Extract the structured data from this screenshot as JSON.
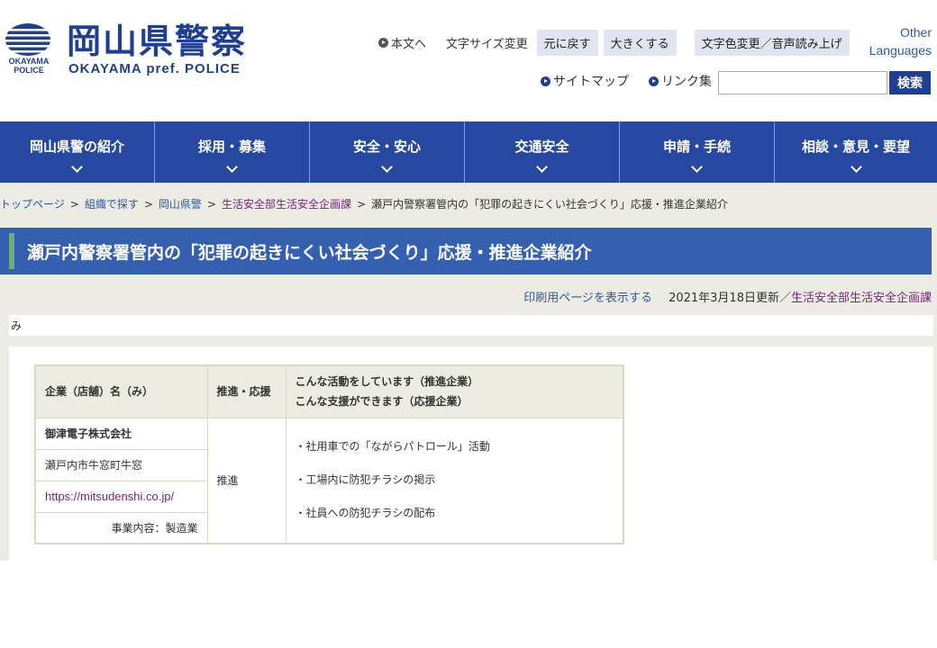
{
  "header": {
    "logo_mark_text": "OKAYAMA POLICE",
    "logo_title": "岡山県警察",
    "logo_sub": "OKAYAMA pref. POLICE",
    "skip_link": "本文へ",
    "font_size_label": "文字サイズ変更",
    "font_reset": "元に戻す",
    "font_larger": "大きくする",
    "color_voice": "文字色変更／音声読み上げ",
    "other_lang_1": "Other",
    "other_lang_2": "Languages",
    "sitemap": "サイトマップ",
    "links": "リンク集",
    "search_placeholder": "",
    "search_button": "検索"
  },
  "nav": {
    "items": [
      {
        "label": "岡山県警の紹介"
      },
      {
        "label": "採用・募集"
      },
      {
        "label": "安全・安心"
      },
      {
        "label": "交通安全"
      },
      {
        "label": "申請・手続"
      },
      {
        "label": "相談・意見・要望"
      }
    ]
  },
  "breadcrumb": {
    "items": [
      "トップページ",
      "組織で探す",
      "岡山県警",
      "生活安全部生活安全企画課",
      "瀬戸内警察署管内の「犯罪の起きにくい社会づくり」応援・推進企業紹介"
    ],
    "separator": ">"
  },
  "page": {
    "title": "瀬戸内警察署管内の「犯罪の起きにくい社会づくり」応援・推進企業紹介",
    "print_link": "印刷用ページを表示する",
    "updated": "2021年3月18日更新／",
    "dept": "生活安全部生活安全企画課",
    "index_char": "み"
  },
  "table": {
    "headers": {
      "company": "企業（店舗）名（み）",
      "type": "推進・応援",
      "activity_1": "こんな活動をしています（推進企業）",
      "activity_2": "こんな支援ができます（応援企業）"
    },
    "row": {
      "name": "御津電子株式会社",
      "address": "瀬戸内市牛窓町牛窓",
      "url": "https://mitsudenshi.co.jp/",
      "business": "事業内容：製造業",
      "type": "推進",
      "activities": [
        "・社用車での「ながらパトロール」活動",
        "・工場内に防犯チラシの掲示",
        "・社員への防犯チラシの配布"
      ]
    }
  },
  "colors": {
    "brand": "#1e3f93",
    "nav_bg": "#2748a0",
    "title_bg": "#355fb0",
    "band_bg": "#ecece4",
    "accent_green": "#6fae7a"
  }
}
